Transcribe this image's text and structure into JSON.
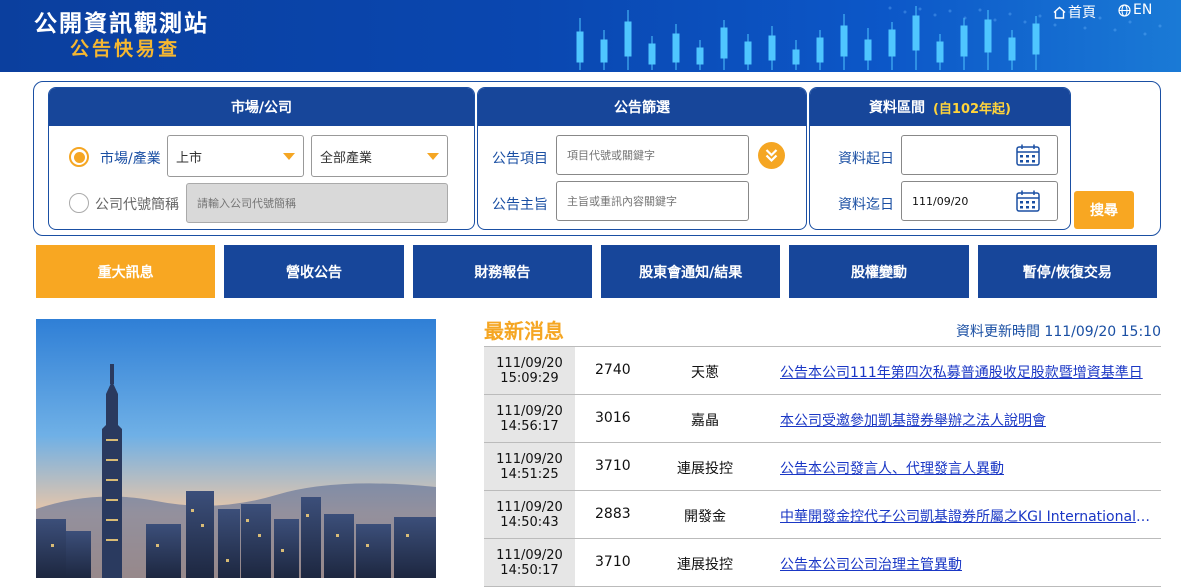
{
  "header": {
    "brand_title": "公開資訊觀測站",
    "brand_subtitle": "公告快易查",
    "nav_home": "首頁",
    "nav_en": "EN"
  },
  "search": {
    "market_box": {
      "title": "市場/公司",
      "radio_market_label": "市場/產業",
      "market_select": "上市",
      "industry_select": "全部產業",
      "radio_company_label": "公司代號簡稱",
      "company_placeholder": "請輸入公司代號簡稱"
    },
    "filter_box": {
      "title": "公告篩選",
      "item_label": "公告項目",
      "item_placeholder": "項目代號或關鍵字",
      "subject_label": "公告主旨",
      "subject_placeholder": "主旨或重訊內容關鍵字"
    },
    "date_box": {
      "title": "資料區間",
      "note": "(自102年起)",
      "start_label": "資料起日",
      "start_value": "",
      "end_label": "資料迄日",
      "end_value": "111/09/20"
    },
    "search_button": "搜尋"
  },
  "tabs": [
    {
      "label": "重大訊息",
      "active": true
    },
    {
      "label": "營收公告",
      "active": false
    },
    {
      "label": "財務報告",
      "active": false
    },
    {
      "label": "股東會通知/結果",
      "active": false
    },
    {
      "label": "股權變動",
      "active": false
    },
    {
      "label": "暫停/恢復交易",
      "active": false
    }
  ],
  "news": {
    "title": "最新消息",
    "updated": "資料更新時間 111/09/20 15:10",
    "rows": [
      {
        "date": "111/09/20",
        "time": "15:09:29",
        "code": "2740",
        "company": "天蔥",
        "subject": "公告本公司111年第四次私募普通股收足股款暨增資基準日"
      },
      {
        "date": "111/09/20",
        "time": "14:56:17",
        "code": "3016",
        "company": "嘉晶",
        "subject": "本公司受邀參加凱基證券舉辦之法人說明會"
      },
      {
        "date": "111/09/20",
        "time": "14:51:25",
        "code": "3710",
        "company": "連展投控",
        "subject": "公告本公司發言人、代理發言人異動"
      },
      {
        "date": "111/09/20",
        "time": "14:50:43",
        "code": "2883",
        "company": "開發金",
        "subject": "中華開發金控代子公司凱基證券所屬之KGI International Holdings Limited公告"
      },
      {
        "date": "111/09/20",
        "time": "14:50:17",
        "code": "3710",
        "company": "連展投控",
        "subject": "公告本公司公司治理主管異動"
      }
    ]
  },
  "colors": {
    "primary": "#17469a",
    "accent": "#f8a722",
    "link": "#1a37c5"
  }
}
